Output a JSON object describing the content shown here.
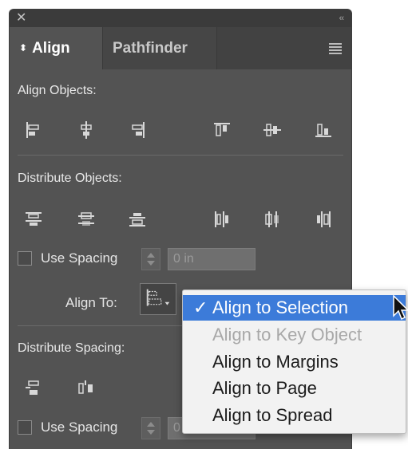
{
  "titlebar": {
    "close_glyph": "✕",
    "collapse_glyph": "‹‹"
  },
  "tabs": [
    {
      "label": "Align",
      "active": true,
      "icon": "up-down-arrows-icon"
    },
    {
      "label": "Pathfinder",
      "active": false
    }
  ],
  "panel_menu_icon": "hamburger-menu-icon",
  "align_objects": {
    "label": "Align Objects:",
    "buttons": [
      "align-left-edges-icon",
      "align-horizontal-centers-icon",
      "align-right-edges-icon",
      "align-top-edges-icon",
      "align-vertical-centers-icon",
      "align-bottom-edges-icon"
    ]
  },
  "distribute_objects": {
    "label": "Distribute Objects:",
    "buttons": [
      "distribute-top-edges-icon",
      "distribute-vertical-centers-icon",
      "distribute-bottom-edges-icon",
      "distribute-left-edges-icon",
      "distribute-horizontal-centers-icon",
      "distribute-right-edges-icon"
    ],
    "use_spacing_label": "Use Spacing",
    "use_spacing_checked": false,
    "spacing_value": "0 in"
  },
  "align_to": {
    "label": "Align To:",
    "options": [
      {
        "label": "Align to Selection",
        "selected": true,
        "disabled": false
      },
      {
        "label": "Align to Key Object",
        "selected": false,
        "disabled": true
      },
      {
        "label": "Align to Margins",
        "selected": false,
        "disabled": false
      },
      {
        "label": "Align to Page",
        "selected": false,
        "disabled": false
      },
      {
        "label": "Align to Spread",
        "selected": false,
        "disabled": false
      }
    ],
    "check_glyph": "✓"
  },
  "distribute_spacing": {
    "label": "Distribute Spacing:",
    "buttons": [
      "distribute-vertical-space-icon",
      "distribute-horizontal-space-icon"
    ],
    "use_spacing_label": "Use Spacing",
    "use_spacing_checked": false,
    "spacing_value": "0"
  },
  "colors": {
    "panel_bg": "#535353",
    "selection_blue": "#3c7bd9",
    "menu_bg": "#f2f2f2"
  }
}
